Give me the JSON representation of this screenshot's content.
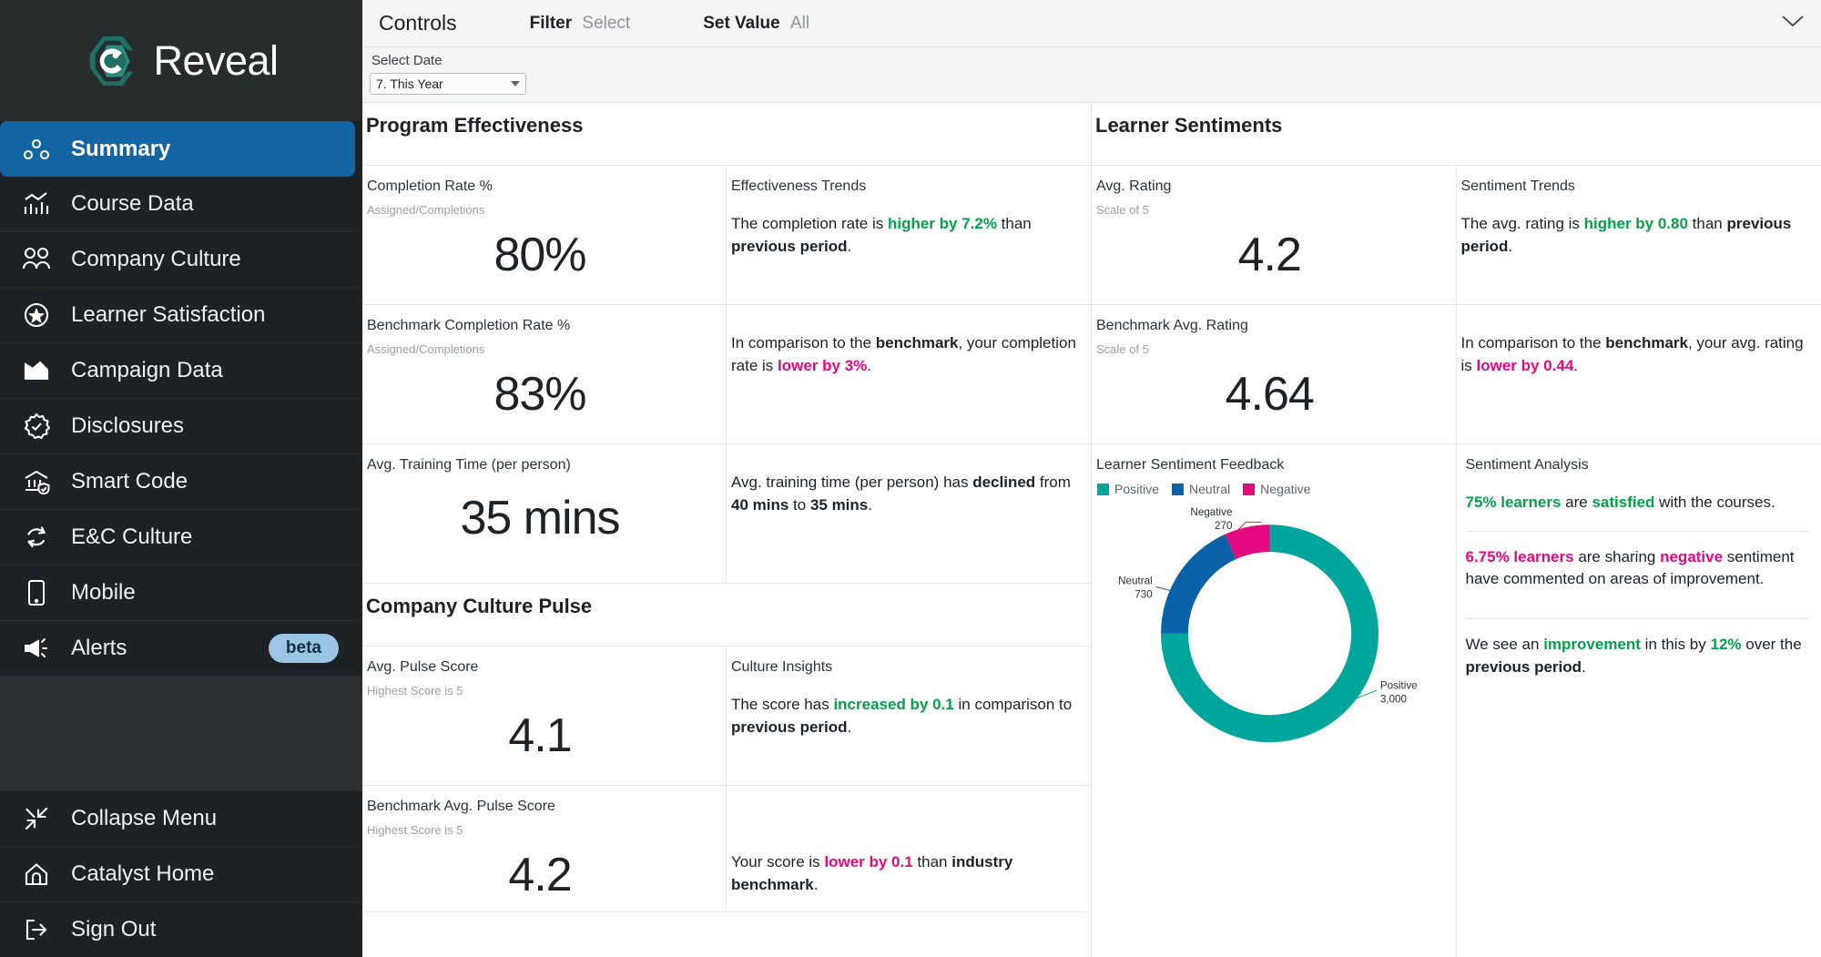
{
  "brand": {
    "name": "Reveal",
    "logo_icon": "reveal-hexagon-c-logo"
  },
  "sidebar": {
    "items": [
      {
        "label": "Summary",
        "icon": "summary-dots-icon",
        "active": true
      },
      {
        "label": "Course Data",
        "icon": "bar-chart-icon",
        "active": false
      },
      {
        "label": "Company Culture",
        "icon": "people-group-icon",
        "active": false
      },
      {
        "label": "Learner Satisfaction",
        "icon": "star-circle-icon",
        "active": false
      },
      {
        "label": "Campaign Data",
        "icon": "image-mountain-icon",
        "active": false
      },
      {
        "label": "Disclosures",
        "icon": "badge-check-icon",
        "active": false
      },
      {
        "label": "Smart Code",
        "icon": "bank-shield-icon",
        "active": false
      },
      {
        "label": "E&C Culture",
        "icon": "refresh-cycle-icon",
        "active": false
      },
      {
        "label": "Mobile",
        "icon": "mobile-phone-icon",
        "active": false
      },
      {
        "label": "Alerts",
        "icon": "megaphone-icon",
        "active": false,
        "badge": "beta"
      }
    ],
    "bottom_items": [
      {
        "label": "Collapse Menu",
        "icon": "collapse-arrows-icon"
      },
      {
        "label": "Catalyst Home",
        "icon": "home-icon"
      },
      {
        "label": "Sign Out",
        "icon": "sign-out-icon"
      }
    ]
  },
  "controls": {
    "title": "Controls",
    "filter_key": "Filter",
    "filter_value": "Select",
    "setvalue_key": "Set Value",
    "setvalue_value": "All",
    "expand_icon": "chevron-down-icon"
  },
  "filters": {
    "date_label": "Select Date",
    "date_value": "7. This Year",
    "date_caret_icon": "caret-down-icon"
  },
  "program_effectiveness": {
    "title": "Program Effectiveness",
    "completion_rate": {
      "label": "Completion Rate %",
      "sub": "Assigned/Completions",
      "value": "80%"
    },
    "benchmark_completion_rate": {
      "label": "Benchmark Completion Rate %",
      "sub": "Assigned/Completions",
      "value": "83%"
    },
    "avg_training_time": {
      "label": "Avg. Training Time (per person)",
      "value": "35 mins"
    },
    "effectiveness_trends": {
      "label": "Effectiveness Trends",
      "text_pre": "The completion rate is ",
      "highlight": "higher by 7.2%",
      "highlight_kind": "positive",
      "text_mid": " than ",
      "bold": "previous period",
      "text_post": "."
    },
    "benchmark_insight": {
      "text_pre": "In comparison to the ",
      "bold1": "benchmark",
      "text_mid": ", your completion rate is ",
      "highlight": "lower by 3%",
      "highlight_kind": "negative",
      "text_post": "."
    },
    "training_time_insight": {
      "text_pre": "Avg. training time (per person) has ",
      "bold1": "declined",
      "text_mid": " from ",
      "bold2": "40 mins",
      "text_mid2": " to ",
      "bold3": "35 mins",
      "text_post": "."
    }
  },
  "learner_sentiments": {
    "title": "Learner Sentiments",
    "avg_rating": {
      "label": "Avg. Rating",
      "sub": "Scale of 5",
      "value": "4.2"
    },
    "benchmark_avg_rating": {
      "label": "Benchmark Avg. Rating",
      "sub": "Scale of 5",
      "value": "4.64"
    },
    "sentiment_trends": {
      "label": "Sentiment Trends",
      "text_pre": "The avg. rating is ",
      "highlight": "higher by 0.80",
      "highlight_kind": "positive",
      "text_mid": " than ",
      "bold": "previous period",
      "text_post": "."
    },
    "benchmark_insight": {
      "text_pre": "In comparison to the ",
      "bold1": "benchmark",
      "text_mid": ", your avg. rating is ",
      "highlight": "lower by 0.44",
      "highlight_kind": "negative",
      "text_post": "."
    },
    "feedback_chart_label": "Learner Sentiment Feedback",
    "sentiment_analysis": {
      "label": "Sentiment Analysis",
      "p1": {
        "h1": "75% learners",
        "mid": " are ",
        "h2": "satisfied",
        "post": " with the courses."
      },
      "p2": {
        "h1": "6.75% learners",
        "mid": " are sharing ",
        "h2": "negative",
        "post": " sentiment have commented on areas of improvement."
      },
      "p3": {
        "pre": "We see an ",
        "h1": "improvement",
        "mid": " in this by ",
        "h2": "12%",
        "post": " over the ",
        "bold": "previous period",
        "end": "."
      }
    }
  },
  "company_culture_pulse": {
    "title": "Company Culture Pulse",
    "avg_pulse_score": {
      "label": "Avg. Pulse Score",
      "sub": "Highest Score is 5",
      "value": "4.1"
    },
    "benchmark_avg_pulse_score": {
      "label": "Benchmark Avg. Pulse Score",
      "sub": "Highest Score is 5",
      "value": "4.2"
    },
    "culture_insights": {
      "label": "Culture Insights",
      "text_pre": "The score has ",
      "highlight": "increased by 0.1",
      "highlight_kind": "positive",
      "text_mid": " in comparison to ",
      "bold": "previous period",
      "text_post": "."
    },
    "benchmark_insight": {
      "text_pre": "Your score is ",
      "highlight": "lower by 0.1",
      "highlight_kind": "negative",
      "text_mid": " than ",
      "bold": "industry benchmark",
      "text_post": "."
    }
  },
  "colors": {
    "positive": "#00A69C",
    "neutral": "#0A63A8",
    "negative": "#E5097F",
    "green_text": "#05a14a",
    "pink_text": "#e5097f",
    "accent_nav": "#1465a3",
    "sidebar_bg": "#1c2226"
  },
  "chart_data": {
    "type": "pie",
    "title": "Learner Sentiment Feedback",
    "categories": [
      "Positive",
      "Neutral",
      "Negative"
    ],
    "values": [
      3000,
      730,
      270
    ],
    "value_labels": [
      "3,000",
      "730",
      "270"
    ],
    "colors": [
      "#00A69C",
      "#0A63A8",
      "#E5097F"
    ],
    "legend": [
      "Positive",
      "Neutral",
      "Negative"
    ],
    "legend_position": "top-left",
    "donut": true,
    "total": 4000
  }
}
